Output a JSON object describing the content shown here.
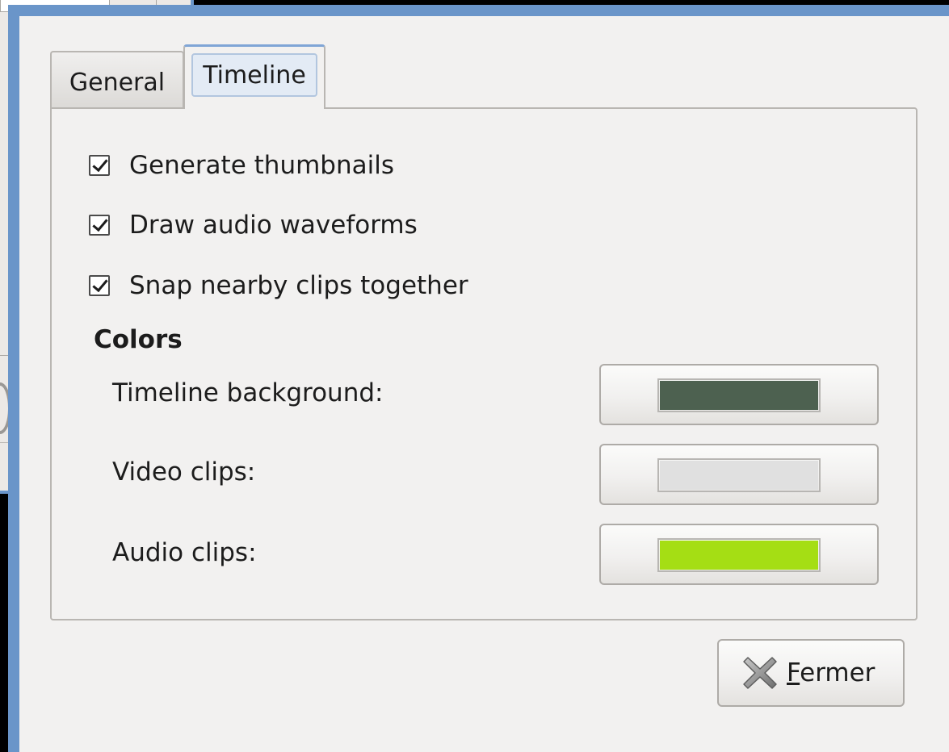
{
  "tabs": [
    {
      "label": "General",
      "active": false
    },
    {
      "label": "Timeline",
      "active": true
    }
  ],
  "options": [
    {
      "label": "Generate thumbnails",
      "checked": true
    },
    {
      "label": "Draw audio waveforms",
      "checked": true
    },
    {
      "label": "Snap nearby clips together",
      "checked": true
    }
  ],
  "colors_section": {
    "heading": "Colors",
    "items": [
      {
        "label": "Timeline background:",
        "color": "#4d6150"
      },
      {
        "label": "Video clips:",
        "color": "#e0e0e0"
      },
      {
        "label": "Audio clips:",
        "color": "#a5de14"
      }
    ]
  },
  "close_button": {
    "mnemonic": "F",
    "rest": "ermer"
  },
  "icons": {
    "close": "close-x-icon"
  },
  "theme": {
    "window_border": "#6a95c9",
    "dialog_bg": "#f2f1f0"
  }
}
